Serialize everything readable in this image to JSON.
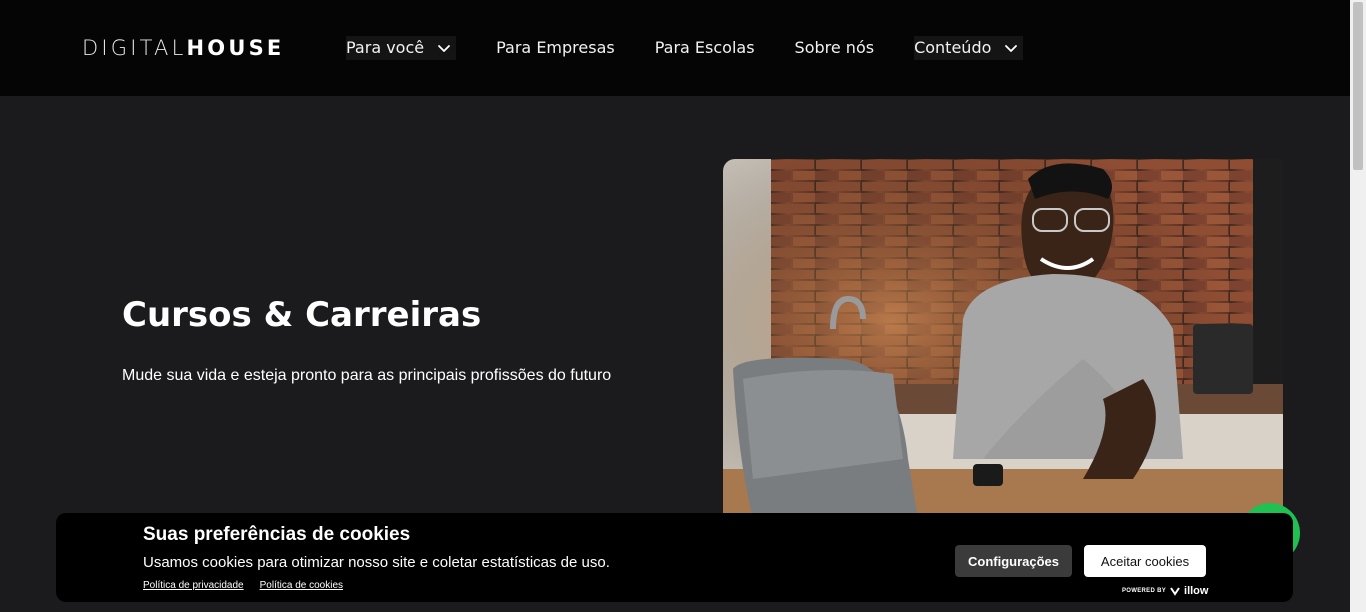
{
  "header": {
    "logo_light": "DIGITAL",
    "logo_bold": "HOUSE",
    "nav": [
      {
        "label": "Para você",
        "has_dropdown": true
      },
      {
        "label": "Para Empresas",
        "has_dropdown": false
      },
      {
        "label": "Para Escolas",
        "has_dropdown": false
      },
      {
        "label": "Sobre nós",
        "has_dropdown": false
      },
      {
        "label": "Conteúdo",
        "has_dropdown": true
      }
    ]
  },
  "hero": {
    "title": "Cursos & Carreiras",
    "subtitle": "Mude sua vida e esteja pronto para as principais profissões do futuro"
  },
  "cookie_banner": {
    "title": "Suas preferências de cookies",
    "text": "Usamos cookies para otimizar nosso site e coletar estatísticas de uso.",
    "links": [
      "Política de privacidade",
      "Política de cookies"
    ],
    "config_button": "Configurações",
    "accept_button": "Aceitar cookies",
    "powered_by": "POWERED BY",
    "powered_brand": "illow"
  },
  "colors": {
    "header_bg": "#050505",
    "page_bg": "#1b1b1e",
    "whatsapp_green": "#1fc152",
    "banner_bg": "#000000"
  },
  "icons": {
    "nav_dropdown": "chevron-down-icon",
    "whatsapp": "whatsapp-icon",
    "powered_brand": "illow-logo-icon"
  }
}
